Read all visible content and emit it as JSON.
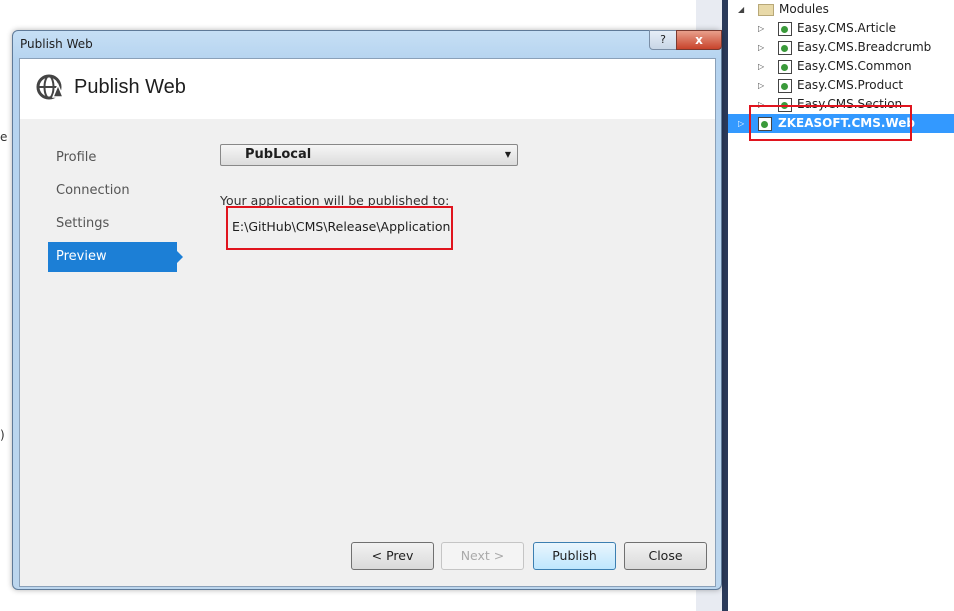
{
  "background": {
    "fragments": [
      "e",
      ")"
    ]
  },
  "solution_explorer": {
    "folder": "Modules",
    "items": [
      {
        "label": "Easy.CMS.Article",
        "selected": false
      },
      {
        "label": "Easy.CMS.Breadcrumb",
        "selected": false
      },
      {
        "label": "Easy.CMS.Common",
        "selected": false
      },
      {
        "label": "Easy.CMS.Product",
        "selected": false
      },
      {
        "label": "Easy.CMS.Section",
        "selected": false
      },
      {
        "label": "ZKEASOFT.CMS.Web",
        "selected": true
      }
    ],
    "selection_color": "#3399ff",
    "highlight_color": "#e0141e"
  },
  "dialog": {
    "title": "Publish Web",
    "help_glyph": "?",
    "close_glyph": "x",
    "header_title": "Publish Web",
    "header_icon": "globe-publish-icon",
    "nav": [
      {
        "label": "Profile",
        "selected": false
      },
      {
        "label": "Connection",
        "selected": false
      },
      {
        "label": "Settings",
        "selected": false
      },
      {
        "label": "Preview",
        "selected": true
      }
    ],
    "profile_value": "PubLocal",
    "publish_to_label": "Your application will be published to:",
    "publish_path": "E:\\GitHub\\CMS\\Release\\Application",
    "buttons": {
      "prev": "< Prev",
      "next": "Next >",
      "publish": "Publish",
      "close": "Close"
    },
    "accent_color": "#1c7fd6"
  }
}
